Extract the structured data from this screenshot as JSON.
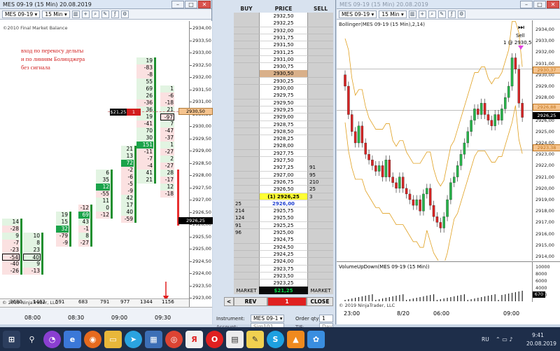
{
  "left_window": {
    "title": "MES 09-19 (15 Min)  20.08.2019",
    "instrument": "MES 09-19",
    "interval": "15 Min",
    "copyright_top": "©2010 Final Market Balance",
    "note_lines": [
      "вход по перекосу дельты",
      "и по линиям Болинджера",
      "без сигнала"
    ],
    "footer_copyright": "© 2019 NinjaTrader, LLC",
    "time_labels": [
      "08:00",
      "08:30",
      "09:00",
      "09:30"
    ],
    "price_labels": [
      "2934,00",
      "2933,50",
      "2933,00",
      "2932,50",
      "2932,00",
      "2931,50",
      "2931,00",
      "2930,50",
      "2930,00",
      "2929,50",
      "2929,00",
      "2928,50",
      "2928,00",
      "2927,50",
      "2927,00",
      "2926,50",
      "2926,00",
      "2925,50",
      "2925,00",
      "2924,50",
      "2924,00",
      "2923,50",
      "2923,00"
    ],
    "last_price_tag": "2926,25",
    "ref_price_tag": "2930,50",
    "row_marker_left": "$21,25",
    "row_marker_mid": "1",
    "bar_totals": [
      "3680",
      "1463",
      "591",
      "683",
      "791",
      "977",
      "1344",
      "1156"
    ],
    "columns": [
      {
        "cells": [
          [
            "14",
            ""
          ],
          [
            "-28",
            ""
          ],
          [
            "9",
            ""
          ],
          [
            "-7",
            ""
          ],
          [
            "-23",
            ""
          ],
          [
            "-54",
            "box"
          ],
          [
            "-40",
            ""
          ],
          [
            "-26",
            ""
          ]
        ]
      },
      {
        "cells": [
          [
            "10",
            ""
          ],
          [
            "8",
            ""
          ],
          [
            "23",
            ""
          ],
          [
            "40",
            "box"
          ],
          [
            "9",
            ""
          ],
          [
            "-13",
            ""
          ]
        ]
      },
      {
        "cells": [
          [
            "19",
            ""
          ],
          [
            "15",
            ""
          ],
          [
            "32",
            "green"
          ],
          [
            "-79",
            ""
          ],
          [
            "-9",
            ""
          ]
        ]
      },
      {
        "cells": [
          [
            "-12",
            ""
          ],
          [
            "69",
            "green"
          ],
          [
            "43",
            ""
          ],
          [
            "-1",
            ""
          ],
          [
            "8",
            ""
          ],
          [
            "-27",
            ""
          ]
        ]
      },
      {
        "cells": [
          [
            "6",
            ""
          ],
          [
            "35",
            ""
          ],
          [
            "12",
            "green"
          ],
          [
            "-55",
            ""
          ],
          [
            "11",
            ""
          ],
          [
            "0",
            ""
          ],
          [
            "-12",
            ""
          ]
        ]
      },
      {
        "cells": [
          [
            "21",
            ""
          ],
          [
            "13",
            ""
          ],
          [
            "72",
            "green"
          ],
          [
            "-2",
            ""
          ],
          [
            "-6",
            ""
          ],
          [
            "-5",
            ""
          ],
          [
            "-9",
            ""
          ],
          [
            "42",
            ""
          ],
          [
            "17",
            ""
          ],
          [
            "40",
            ""
          ],
          [
            "-59",
            ""
          ]
        ]
      },
      {
        "cells": [
          [
            "19",
            ""
          ],
          [
            "-83",
            ""
          ],
          [
            "-8",
            ""
          ],
          [
            "55",
            ""
          ],
          [
            "69",
            ""
          ],
          [
            "26",
            ""
          ],
          [
            "-36",
            ""
          ],
          [
            "36",
            ""
          ],
          [
            "19",
            ""
          ],
          [
            "-41",
            ""
          ],
          [
            "70",
            ""
          ],
          [
            "30",
            ""
          ],
          [
            "151",
            "green"
          ],
          [
            "-11",
            ""
          ],
          [
            "-7",
            ""
          ],
          [
            "-4",
            ""
          ],
          [
            "41",
            ""
          ],
          [
            "21",
            ""
          ]
        ]
      },
      {
        "cells": [
          [
            "1",
            ""
          ],
          [
            "-6",
            ""
          ],
          [
            "-18",
            ""
          ],
          [
            "21",
            ""
          ],
          [
            "-97",
            "box"
          ],
          [
            "7",
            ""
          ],
          [
            "-47",
            ""
          ],
          [
            "-37",
            ""
          ],
          [
            "1",
            ""
          ],
          [
            "-27",
            ""
          ],
          [
            "2",
            ""
          ],
          [
            "-27",
            ""
          ],
          [
            "28",
            ""
          ],
          [
            "-17",
            ""
          ],
          [
            "12",
            ""
          ],
          [
            "-18",
            ""
          ]
        ]
      }
    ],
    "arrow_color": "#e02020"
  },
  "dom": {
    "headers": {
      "buy": "BUY",
      "price": "PRICE",
      "sell": "SELL"
    },
    "rows": [
      {
        "buy": "",
        "price": "2932,50",
        "sell": ""
      },
      {
        "buy": "",
        "price": "2932,25",
        "sell": ""
      },
      {
        "buy": "",
        "price": "2932,00",
        "sell": ""
      },
      {
        "buy": "",
        "price": "2931,75",
        "sell": ""
      },
      {
        "buy": "",
        "price": "2931,50",
        "sell": ""
      },
      {
        "buy": "",
        "price": "2931,25",
        "sell": ""
      },
      {
        "buy": "",
        "price": "2931,00",
        "sell": ""
      },
      {
        "buy": "",
        "price": "2930,75",
        "sell": ""
      },
      {
        "buy": "",
        "price": "2930,50",
        "sell": "",
        "hl": "tan"
      },
      {
        "buy": "",
        "price": "2930,25",
        "sell": ""
      },
      {
        "buy": "",
        "price": "2930,00",
        "sell": ""
      },
      {
        "buy": "",
        "price": "2929,75",
        "sell": ""
      },
      {
        "buy": "",
        "price": "2929,50",
        "sell": ""
      },
      {
        "buy": "",
        "price": "2929,25",
        "sell": ""
      },
      {
        "buy": "",
        "price": "2929,00",
        "sell": ""
      },
      {
        "buy": "",
        "price": "2928,75",
        "sell": ""
      },
      {
        "buy": "",
        "price": "2928,50",
        "sell": ""
      },
      {
        "buy": "",
        "price": "2928,25",
        "sell": ""
      },
      {
        "buy": "",
        "price": "2928,00",
        "sell": ""
      },
      {
        "buy": "",
        "price": "2927,75",
        "sell": ""
      },
      {
        "buy": "",
        "price": "2927,50",
        "sell": ""
      },
      {
        "buy": "",
        "price": "2927,25",
        "sell": "91"
      },
      {
        "buy": "",
        "price": "2927,00",
        "sell": "95"
      },
      {
        "buy": "",
        "price": "2926,75",
        "sell": "210"
      },
      {
        "buy": "",
        "price": "2926,50",
        "sell": "25"
      },
      {
        "buy": "",
        "price": "(1) 2926,25",
        "sell": "3",
        "hl": "yellow"
      },
      {
        "buy": "25",
        "price": "2926,00",
        "sell": "",
        "hl": "blue"
      },
      {
        "buy": "214",
        "price": "2925,75",
        "sell": ""
      },
      {
        "buy": "124",
        "price": "2925,50",
        "sell": ""
      },
      {
        "buy": "91",
        "price": "2925,25",
        "sell": ""
      },
      {
        "buy": "96",
        "price": "2925,00",
        "sell": ""
      },
      {
        "buy": "",
        "price": "2924,75",
        "sell": ""
      },
      {
        "buy": "",
        "price": "2924,50",
        "sell": ""
      },
      {
        "buy": "",
        "price": "2924,25",
        "sell": ""
      },
      {
        "buy": "",
        "price": "2924,00",
        "sell": ""
      },
      {
        "buy": "",
        "price": "2923,75",
        "sell": ""
      },
      {
        "buy": "",
        "price": "2923,50",
        "sell": ""
      },
      {
        "buy": "",
        "price": "2923,25",
        "sell": ""
      }
    ],
    "market_buy": "MARKET",
    "pnl": "$21,25",
    "market_sell": "MARKET",
    "rev": "REV",
    "position_qty": "1",
    "close": "CLOSE",
    "back": "<",
    "instrument_label": "Instrument:",
    "instrument_value": "MES 09-1",
    "order_qty_label": "Order qty:",
    "order_qty_value": "1",
    "account_label": "Account:",
    "account_value": "Sim101",
    "tif_label": "TIF:",
    "tif_value": "Day"
  },
  "right_window": {
    "title": "MES 09-19 (15 Min)  20.08.2019",
    "instrument": "MES 09-19",
    "interval": "15 Min",
    "indicator_label": "Bollinger(MES 09-19 (15 Min),2,14)",
    "volume_label": "VolumeUpDown(MES 09-19 (15 Min))",
    "sell_label": "Sell",
    "sell_detail": "1 @ 2930,50",
    "footer_copyright": "© 2019 NinjaTrader, LLC",
    "price_labels": [
      "2934,00",
      "2933,00",
      "2932,00",
      "2931,00",
      "2930,00",
      "2929,00",
      "2928,00",
      "2927,00",
      "2926,00",
      "2925,00",
      "2924,00",
      "2923,00",
      "2922,00",
      "2921,00",
      "2920,00",
      "2919,00",
      "2918,00",
      "2917,00",
      "2916,00",
      "2915,00",
      "2914,00"
    ],
    "tag_upper": "2930,37",
    "tag_mid": "2926,88",
    "tag_last": "2926,25",
    "tag_lower": "2923,38",
    "volume_labels": [
      "10000",
      "8000",
      "6000",
      "4000",
      "2000"
    ],
    "volume_tag": "670",
    "date_labels": [
      "23:00",
      "8/20",
      "06:00",
      "09:00"
    ]
  },
  "taskbar": {
    "icons": [
      "start-icon",
      "search-icon",
      "assistant-icon",
      "browser-icon",
      "firefox-icon",
      "folder-icon",
      "telegram-icon",
      "store-icon",
      "chrome-icon",
      "yandex-icon",
      "opera-icon",
      "ninjatrader-icon",
      "notes-icon",
      "skype-icon",
      "vlc-icon",
      "paint-icon"
    ],
    "language": "RU",
    "time": "9:41",
    "date": "20.08.2019"
  }
}
